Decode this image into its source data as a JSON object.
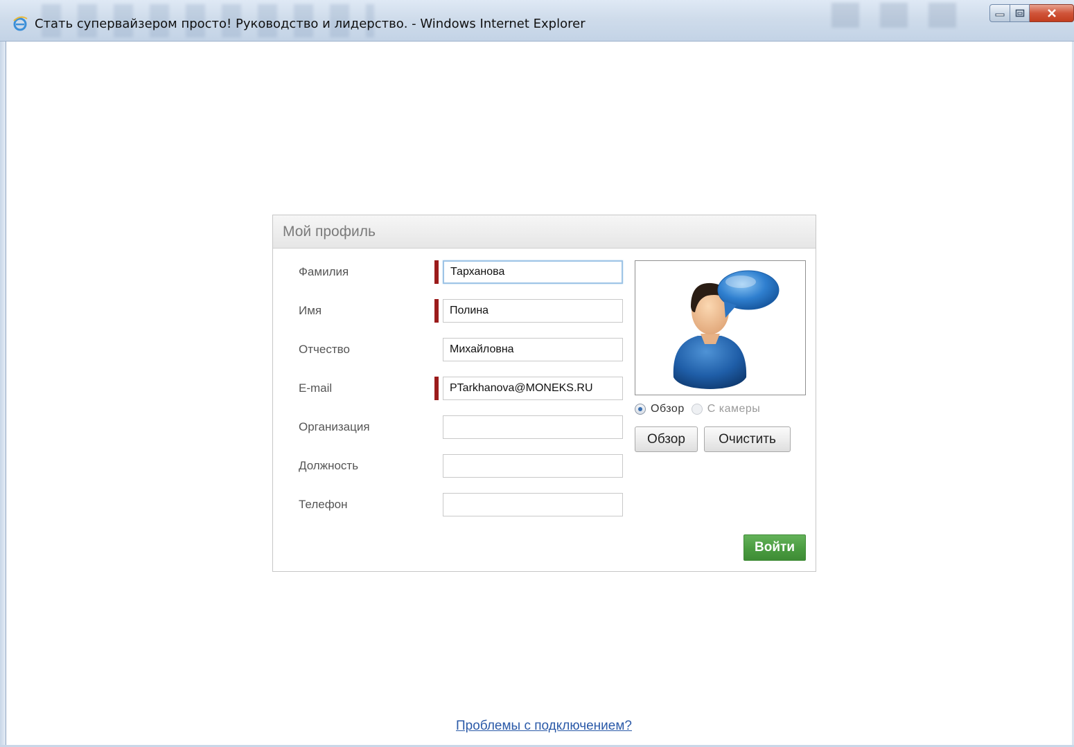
{
  "window": {
    "title": "Стать супервайзером просто! Руководство и лидерство. - Windows Internet Explorer"
  },
  "profile": {
    "header": "Мой профиль",
    "fields": [
      {
        "label": "Фамилия",
        "value": "Тарханова",
        "required": true
      },
      {
        "label": "Имя",
        "value": "Полина",
        "required": true
      },
      {
        "label": "Отчество",
        "value": "Михайловна",
        "required": false
      },
      {
        "label": "E-mail",
        "value": "PTarkhanova@MONEKS.RU",
        "required": true
      },
      {
        "label": "Организация",
        "value": "",
        "required": false
      },
      {
        "label": "Должность",
        "value": "",
        "required": false
      },
      {
        "label": "Телефон",
        "value": "",
        "required": false
      }
    ],
    "photo": {
      "icon": "user-avatar-speech-bubble-icon",
      "source_options": [
        "Обзор",
        "С камеры"
      ],
      "selected_source": "Обзор",
      "browse_label": "Обзор",
      "clear_label": "Очистить"
    },
    "login_label": "Войти"
  },
  "help_link": "Проблемы с подключением?",
  "colors": {
    "required_marker": "#9b1b1b",
    "login_button": "#4a9c40",
    "link": "#2b5aa8"
  }
}
